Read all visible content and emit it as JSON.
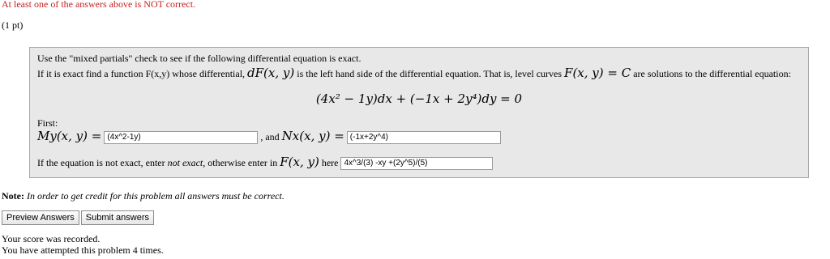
{
  "warning_text": "At least one of the answers above is NOT correct.",
  "points_text": "(1 pt)",
  "problem": {
    "line1": "Use the \"mixed partials\" check to see if the following differential equation is exact.",
    "line2_a": "If it is exact find a function F(x,y) whose differential,",
    "line2_math1": "dF(x, y)",
    "line2_b": "is the left hand side of the differential equation. That is, level curves",
    "line2_math2": "F(x, y) = C",
    "line2_c": "are solutions to the differential equation:",
    "equation": "(4x² − 1y)dx + (−1x + 2y⁴)dy = 0",
    "first_label": "First:",
    "my_label": "My(x, y) =",
    "my_value": "(4x^2-1y)",
    "and_label": ", and",
    "nx_label": "Nx(x, y) =",
    "nx_value": "(-1x+2y^4)",
    "final_a": "If the equation is not exact, enter",
    "final_italic": "not exact,",
    "final_b": "otherwise enter in",
    "final_math": "F(x, y)",
    "final_c": "here",
    "f_value": "4x^3/(3) -xy +(2y^5)/(5)"
  },
  "note_label": "Note:",
  "note_text": "In order to get credit for this problem all answers must be correct.",
  "buttons": {
    "preview": "Preview Answers",
    "submit": "Submit answers"
  },
  "status_line1": "Your score was recorded.",
  "status_line2": "You have attempted this problem 4 times.",
  "colors": {
    "warning": "#c81e1e",
    "panel_bg": "#e8e8e8"
  }
}
